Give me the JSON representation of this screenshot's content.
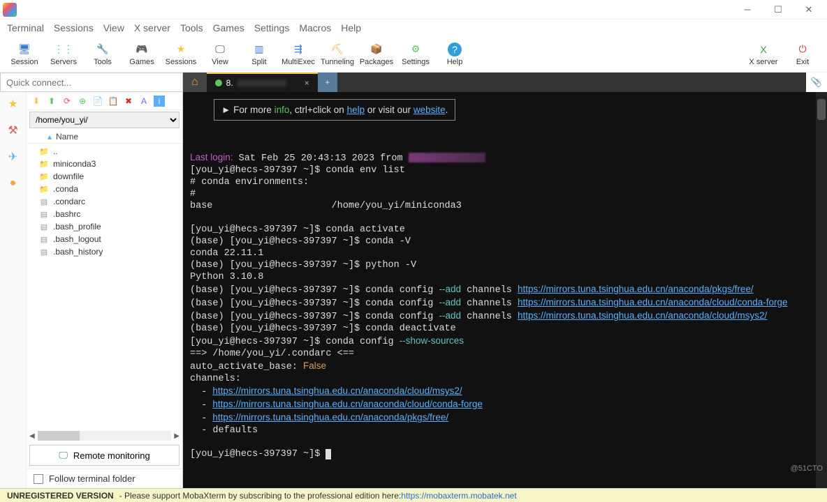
{
  "menubar": [
    "Terminal",
    "Sessions",
    "View",
    "X server",
    "Tools",
    "Games",
    "Settings",
    "Macros",
    "Help"
  ],
  "toolbar_left": [
    {
      "label": "Session",
      "icon": "🖥",
      "color": "#3a7ad4"
    },
    {
      "label": "Servers",
      "icon": "⋮⋮",
      "color": "#5cc5a0"
    },
    {
      "label": "Tools",
      "icon": "🔧",
      "color": "#d85c5c"
    },
    {
      "label": "Games",
      "icon": "🎮",
      "color": "#888"
    },
    {
      "label": "Sessions",
      "icon": "★",
      "color": "#f5c542"
    },
    {
      "label": "View",
      "icon": "🖵",
      "color": "#333"
    },
    {
      "label": "Split",
      "icon": "▥",
      "color": "#3a7ad4"
    },
    {
      "label": "MultiExec",
      "icon": "⇶",
      "color": "#3a7ad4"
    },
    {
      "label": "Tunneling",
      "icon": "⛏",
      "color": "#f5a542"
    },
    {
      "label": "Packages",
      "icon": "📦",
      "color": "#888"
    },
    {
      "label": "Settings",
      "icon": "⚙",
      "color": "#5cc55c"
    },
    {
      "label": "Help",
      "icon": "?",
      "color": "#329fd9"
    }
  ],
  "toolbar_right": [
    {
      "label": "X server",
      "icon": "X",
      "color": "#3a9a3a"
    },
    {
      "label": "Exit",
      "icon": "⏻",
      "color": "#d82a2a"
    }
  ],
  "quick_connect_placeholder": "Quick connect...",
  "tabs": {
    "home_icon": "⌂",
    "active_label": "8.",
    "new_icon": "+"
  },
  "sidebar": {
    "path": "/home/you_yi/",
    "name_header": "Name",
    "items": [
      {
        "label": "..",
        "type": "folderg"
      },
      {
        "label": "miniconda3",
        "type": "folder"
      },
      {
        "label": "downfile",
        "type": "folder"
      },
      {
        "label": ".conda",
        "type": "folder"
      },
      {
        "label": ".condarc",
        "type": "file"
      },
      {
        "label": ".bashrc",
        "type": "file"
      },
      {
        "label": ".bash_profile",
        "type": "file"
      },
      {
        "label": ".bash_logout",
        "type": "file"
      },
      {
        "label": ".bash_history",
        "type": "file"
      }
    ],
    "remote_monitoring": "Remote monitoring",
    "follow_terminal": "Follow terminal folder"
  },
  "terminal": {
    "info_banner_pre": "► For more ",
    "info_word": "info",
    "info_banner_mid": ", ctrl+click on ",
    "help_word": "help",
    "info_banner_mid2": " or visit our ",
    "website_word": "website",
    "info_banner_end": ".",
    "last_login_label": "Last login:",
    "last_login_value": " Sat Feb 25 20:43:13 2023 from ",
    "prompt1": "[you_yi@hecs-397397 ~]$ ",
    "cmd_envlist": "conda env list",
    "envhdr": "# conda environments:",
    "hash": "#",
    "env_base": "base                     /home/you_yi/miniconda3",
    "cmd_activate": "conda activate",
    "base_prompt": "(base) [you_yi@hecs-397397 ~]$ ",
    "cmd_condav": "conda -V",
    "conda_version": "conda 22.11.1",
    "cmd_pyv": "python -V",
    "py_version": "Python 3.10.8",
    "cmd_cfg_pre": "conda config ",
    "cmd_cfg_add": "--add",
    "cmd_cfg_ch": " channels ",
    "url1": "https://mirrors.tuna.tsinghua.edu.cn/anaconda/pkgs/free/",
    "url2": "https://mirrors.tuna.tsinghua.edu.cn/anaconda/cloud/conda-forge",
    "url3": "https://mirrors.tuna.tsinghua.edu.cn/anaconda/cloud/msys2/",
    "cmd_deact": "conda deactivate",
    "cmd_show": "conda config ",
    "cmd_show_flag": "--show-sources",
    "condarc_path": "==> /home/you_yi/.condarc <==",
    "aab": "auto_activate_base: ",
    "aab_val": "False",
    "channels_hdr": "channels:",
    "ch1": "https://mirrors.tuna.tsinghua.edu.cn/anaconda/cloud/msys2/",
    "ch2": "https://mirrors.tuna.tsinghua.edu.cn/anaconda/cloud/conda-forge",
    "ch3": "https://mirrors.tuna.tsinghua.edu.cn/anaconda/pkgs/free/",
    "ch4": "defaults"
  },
  "status": {
    "unreg": "UNREGISTERED VERSION",
    "msg": " -   Please support MobaXterm by subscribing to the professional edition here:  ",
    "url": "https://mobaxterm.mobatek.net"
  },
  "watermark": "@51CTO"
}
